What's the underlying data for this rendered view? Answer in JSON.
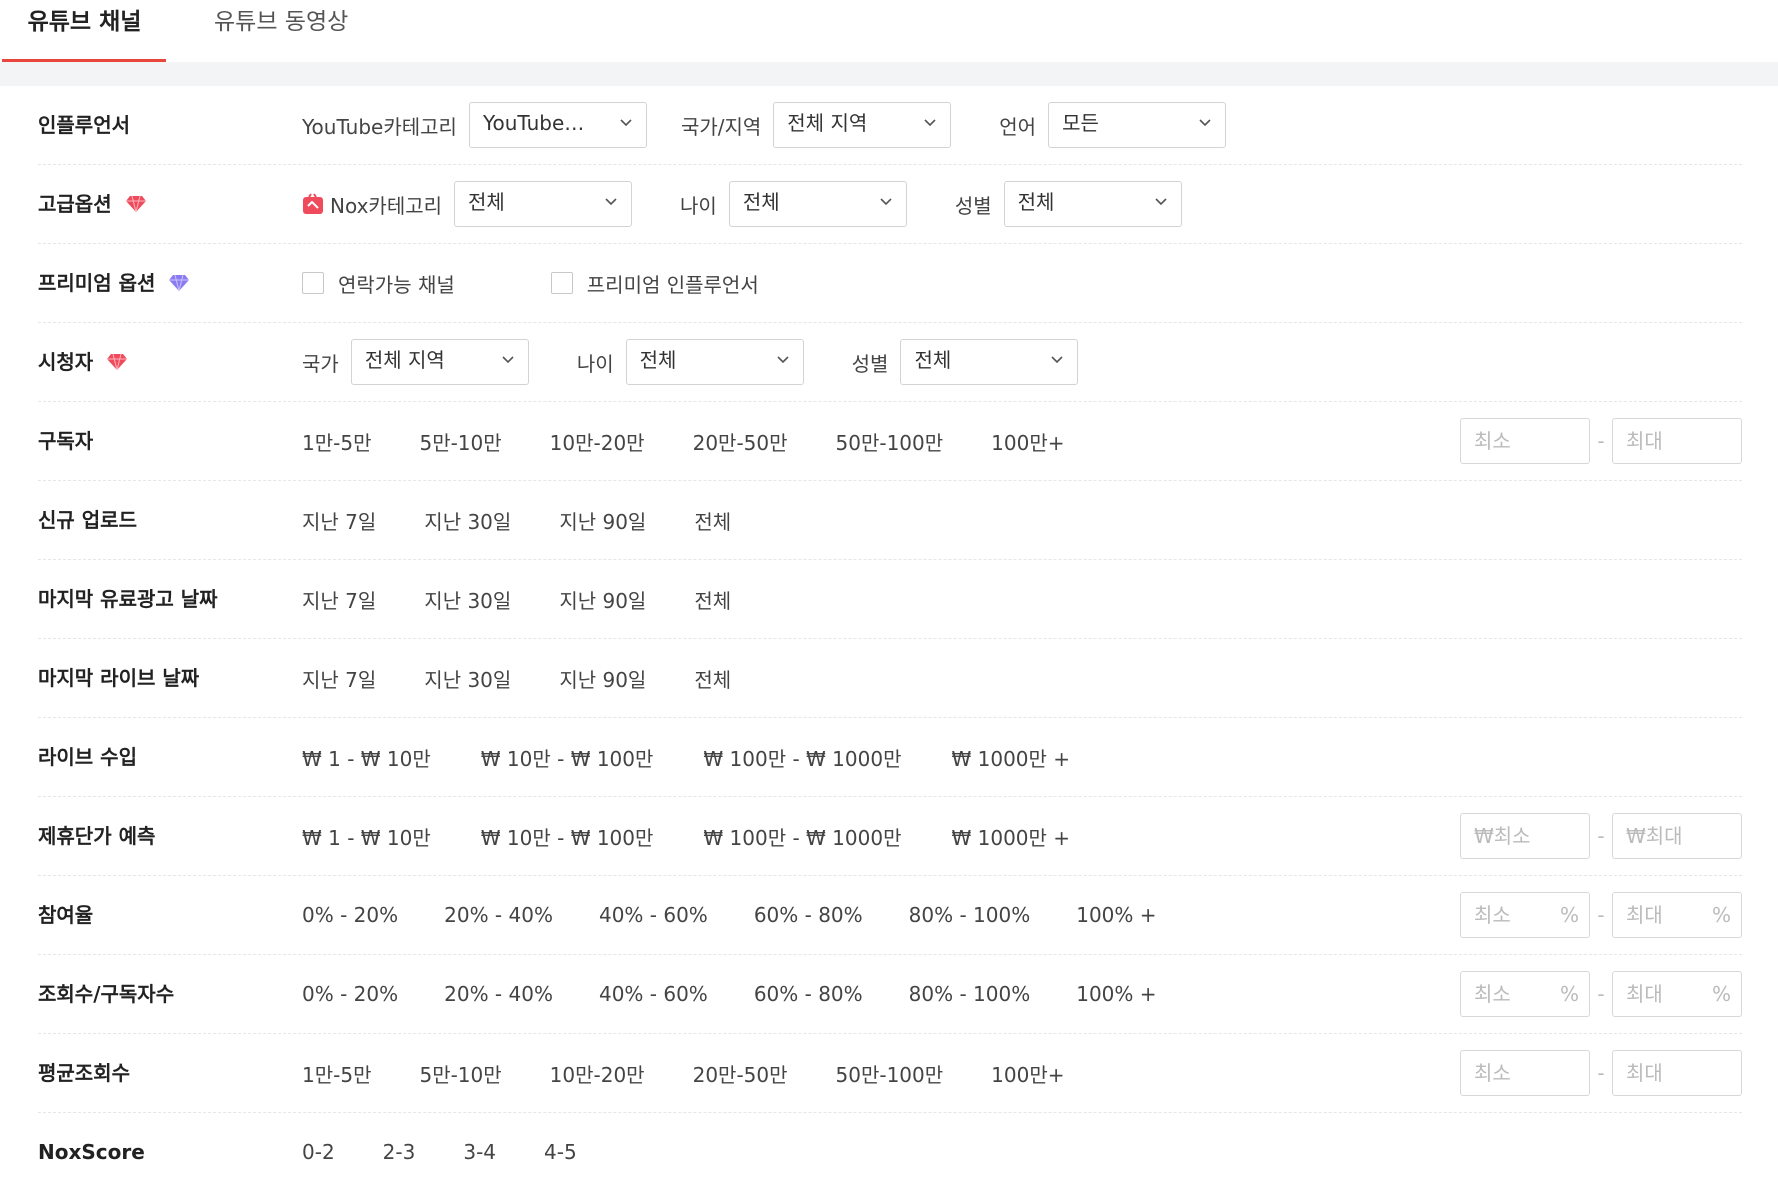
{
  "tabs": {
    "channel": "유튜브 채널",
    "video": "유튜브 동영상"
  },
  "colors": {
    "accent": "#e8453c",
    "gem_red": "#ef4b5c",
    "gem_purple": "#8a7cf0"
  },
  "rows": {
    "influencer": {
      "label": "인플루언서",
      "category_label": "YouTube카테고리",
      "category_value": "YouTube…",
      "country_label": "국가/지역",
      "country_value": "전체 지역",
      "language_label": "언어",
      "language_value": "모든"
    },
    "advanced": {
      "label": "고급옵션",
      "nox_label": "Nox카테고리",
      "nox_value": "전체",
      "age_label": "나이",
      "age_value": "전체",
      "gender_label": "성별",
      "gender_value": "전체"
    },
    "premium": {
      "label": "프리미엄 옵션",
      "check1": "연락가능 채널",
      "check2": "프리미엄 인플루언서"
    },
    "viewers": {
      "label": "시청자",
      "country_label": "국가",
      "country_value": "전체 지역",
      "age_label": "나이",
      "age_value": "전체",
      "gender_label": "성별",
      "gender_value": "전체"
    },
    "subscribers": {
      "label": "구독자",
      "options": [
        "1만-5만",
        "5만-10만",
        "10만-20만",
        "20만-50만",
        "50만-100만",
        "100만+"
      ],
      "min": "최소",
      "max": "최대"
    },
    "new_upload": {
      "label": "신규 업로드",
      "options": [
        "지난 7일",
        "지난 30일",
        "지난 90일",
        "전체"
      ]
    },
    "last_paid_ad": {
      "label": "마지막 유료광고 날짜",
      "options": [
        "지난 7일",
        "지난 30일",
        "지난 90일",
        "전체"
      ]
    },
    "last_live": {
      "label": "마지막 라이브 날짜",
      "options": [
        "지난 7일",
        "지난 30일",
        "지난 90일",
        "전체"
      ]
    },
    "live_income": {
      "label": "라이브 수입",
      "options": [
        "₩ 1 - ₩ 10만",
        "₩ 10만 - ₩ 100만",
        "₩ 100만 - ₩ 1000만",
        "₩ 1000만 +"
      ]
    },
    "affiliate_price": {
      "label": "제휴단가 예측",
      "options": [
        "₩ 1 - ₩ 10만",
        "₩ 10만 - ₩ 100만",
        "₩ 100만 - ₩ 1000만",
        "₩ 1000만 +"
      ],
      "min": "₩최소",
      "max": "₩최대"
    },
    "engagement": {
      "label": "참여율",
      "options": [
        "0% - 20%",
        "20% - 40%",
        "40% - 60%",
        "60% - 80%",
        "80% - 100%",
        "100% +"
      ],
      "min": "최소",
      "max": "최대",
      "unit": "%"
    },
    "views_per_sub": {
      "label": "조회수/구독자수",
      "options": [
        "0% - 20%",
        "20% - 40%",
        "40% - 60%",
        "60% - 80%",
        "80% - 100%",
        "100% +"
      ],
      "min": "최소",
      "max": "최대",
      "unit": "%"
    },
    "avg_views": {
      "label": "평균조회수",
      "options": [
        "1만-5만",
        "5만-10만",
        "10만-20만",
        "20만-50만",
        "50만-100만",
        "100만+"
      ],
      "min": "최소",
      "max": "최대"
    },
    "nox_score": {
      "label": "NoxScore",
      "options": [
        "0-2",
        "2-3",
        "3-4",
        "4-5"
      ]
    }
  }
}
